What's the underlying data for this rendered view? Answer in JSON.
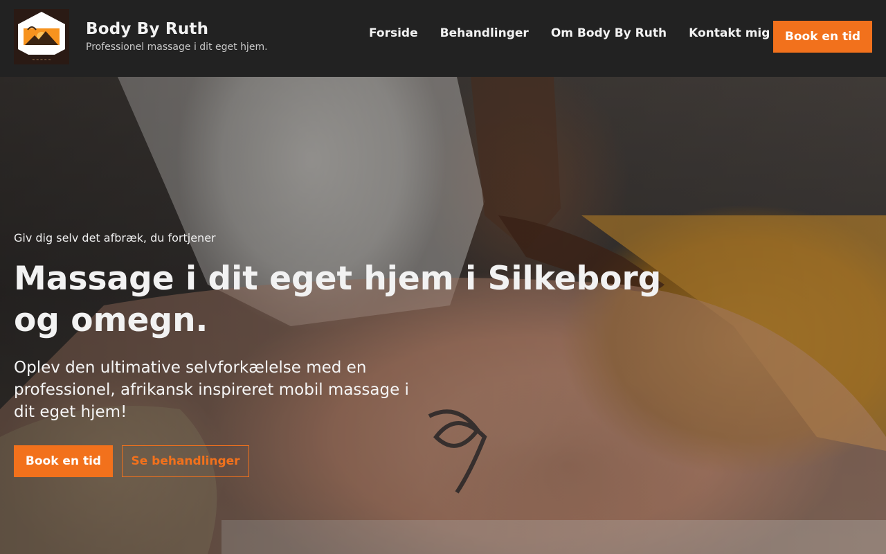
{
  "header": {
    "brand_title": "Body By Ruth",
    "tagline": "Professionel massage i dit eget hjem.",
    "logo_text": "Body By Ruth",
    "nav": [
      {
        "label": "Forside"
      },
      {
        "label": "Behandlinger"
      },
      {
        "label": "Om Body By Ruth"
      },
      {
        "label": "Kontakt mig"
      }
    ],
    "cta_label": "Book en tid"
  },
  "hero": {
    "eyebrow": "Giv dig selv det afbræk, du fortjener",
    "title": "Massage i dit eget hjem i Silkeborg og omegn.",
    "text": "Oplev den ultimative selvforkælelse med en professionel, afrikansk inspireret mobil massage i dit eget hjem!",
    "primary_button": "Book en tid",
    "secondary_button": "Se behandlinger",
    "background_image": "massage-photo"
  },
  "colors": {
    "accent": "#f2711c",
    "header_bg": "#222222",
    "text": "#f2f2f2"
  }
}
